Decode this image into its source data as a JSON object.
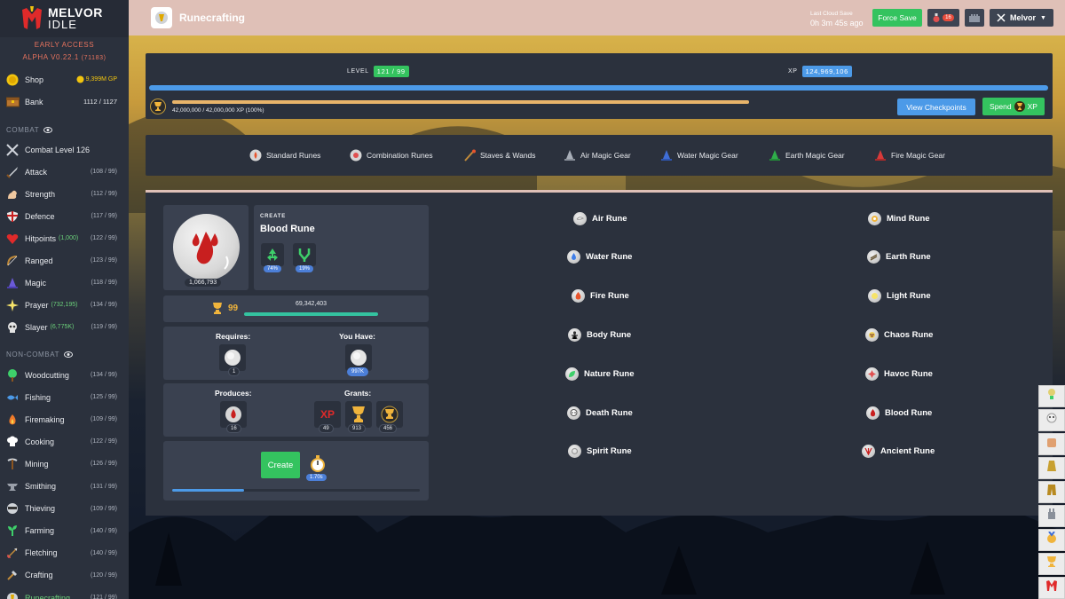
{
  "app": {
    "logo_line1": "MELVOR",
    "logo_line2": "IDLE",
    "version_line1": "EARLY ACCESS",
    "version_line2": "ALPHA V0.22.1",
    "version_build": "(71183)"
  },
  "sidebar": {
    "shop": {
      "label": "Shop",
      "gp": "9,399M GP"
    },
    "bank": {
      "label": "Bank",
      "count": "1112 / 1127"
    },
    "combat_section": "COMBAT",
    "combat_level": "Combat Level 126",
    "combat_skills": [
      {
        "label": "Attack",
        "sub": "",
        "level": "(108 / 99)"
      },
      {
        "label": "Strength",
        "sub": "",
        "level": "(112 / 99)"
      },
      {
        "label": "Defence",
        "sub": "",
        "level": "(117 / 99)"
      },
      {
        "label": "Hitpoints",
        "sub": "(1,000)",
        "level": "(122 / 99)"
      },
      {
        "label": "Ranged",
        "sub": "",
        "level": "(123 / 99)"
      },
      {
        "label": "Magic",
        "sub": "",
        "level": "(118 / 99)"
      },
      {
        "label": "Prayer",
        "sub": "(732,195)",
        "level": "(134 / 99)"
      },
      {
        "label": "Slayer",
        "sub": "(6,775K)",
        "level": "(119 / 99)"
      }
    ],
    "noncombat_section": "NON-COMBAT",
    "noncombat_skills": [
      {
        "label": "Woodcutting",
        "level": "(134 / 99)"
      },
      {
        "label": "Fishing",
        "level": "(125 / 99)"
      },
      {
        "label": "Firemaking",
        "level": "(109 / 99)"
      },
      {
        "label": "Cooking",
        "level": "(122 / 99)"
      },
      {
        "label": "Mining",
        "level": "(126 / 99)"
      },
      {
        "label": "Smithing",
        "level": "(131 / 99)"
      },
      {
        "label": "Thieving",
        "level": "(109 / 99)"
      },
      {
        "label": "Farming",
        "level": "(140 / 99)"
      },
      {
        "label": "Fletching",
        "level": "(140 / 99)"
      },
      {
        "label": "Crafting",
        "level": "(120 / 99)"
      },
      {
        "label": "Runecrafting",
        "level": "(121 / 99)"
      }
    ]
  },
  "header": {
    "title": "Runecrafting",
    "cloud_label": "Last Cloud Save",
    "cloud_time": "0h 3m 45s ago",
    "force_save": "Force Save",
    "notifications": "16",
    "character": "Melvor"
  },
  "xp_panel": {
    "level_label": "LEVEL",
    "level_value": "121 / 99",
    "xp_label": "XP",
    "xp_value": "124,969,106",
    "xp_progress": 1.0,
    "mastery_text": "42,000,000 / 42,000,000 XP (100%)",
    "mastery_progress": 1.0,
    "view_checkpoints": "View Checkpoints",
    "spend": "Spend",
    "spend_xp": "XP"
  },
  "categories": [
    "Standard Runes",
    "Combination Runes",
    "Staves & Wands",
    "Air Magic Gear",
    "Water Magic Gear",
    "Earth Magic Gear",
    "Fire Magic Gear"
  ],
  "selected": {
    "quantity": "1,066,793",
    "create_label": "CREATE",
    "name": "Blood Rune",
    "preserve_pct": "74%",
    "double_pct": "19%",
    "mastery_level": "99",
    "mastery_xp": "69,342,403",
    "mastery_progress": 1.0,
    "requires_label": "Requires:",
    "requires_qty": "1",
    "you_have_label": "You Have:",
    "you_have_qty": "997K",
    "produces_label": "Produces:",
    "produces_qty": "16",
    "grants_label": "Grants:",
    "grants_xp_icon": "XP",
    "grants_xp": "49",
    "grants_mastery": "913",
    "grants_pool": "456",
    "create_button": "Create",
    "interval": "1.70s",
    "action_progress": 0.29
  },
  "runes_left": [
    "Air Rune",
    "Water Rune",
    "Fire Rune",
    "Body Rune",
    "Nature Rune",
    "Death Rune",
    "Spirit Rune"
  ],
  "runes_right": [
    "Mind Rune",
    "Earth Rune",
    "Light Rune",
    "Chaos Rune",
    "Havoc Rune",
    "Blood Rune",
    "Ancient Rune"
  ],
  "colors": {
    "accent_green": "#34c35f",
    "accent_blue": "#4c9ae8",
    "header_bg": "#dfc0b7",
    "panel_bg": "#2b313d",
    "mastery_gold": "#f0b43c"
  }
}
